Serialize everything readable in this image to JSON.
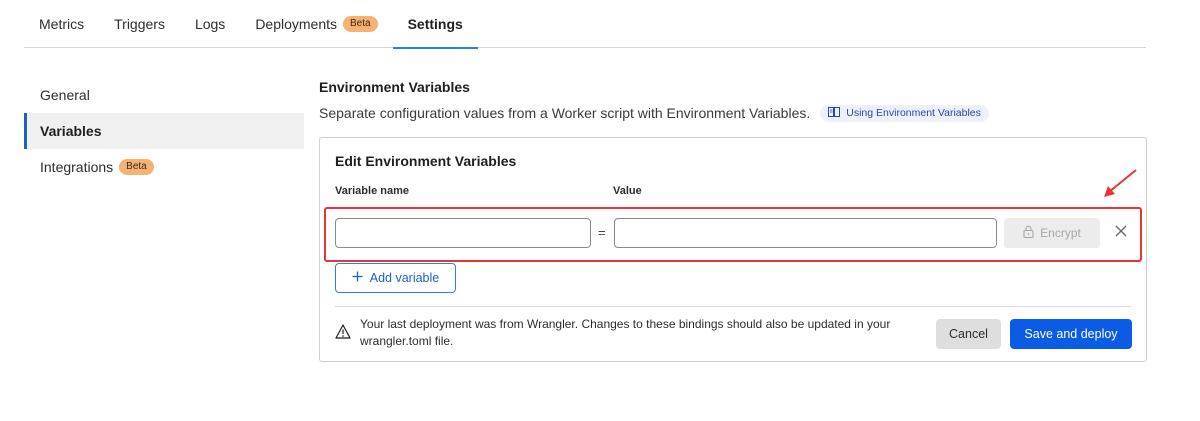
{
  "tabs": [
    {
      "label": "Metrics"
    },
    {
      "label": "Triggers"
    },
    {
      "label": "Logs"
    },
    {
      "label": "Deployments",
      "badge": "Beta"
    },
    {
      "label": "Settings",
      "active": true
    }
  ],
  "sidebar": {
    "items": [
      {
        "label": "General"
      },
      {
        "label": "Variables",
        "active": true
      },
      {
        "label": "Integrations",
        "badge": "Beta"
      }
    ]
  },
  "main": {
    "title": "Environment Variables",
    "description": "Separate configuration values from a Worker script with Environment Variables.",
    "doc_link": "Using Environment Variables",
    "card": {
      "title": "Edit Environment Variables",
      "name_label": "Variable name",
      "value_label": "Value",
      "name_value": "",
      "value_value": "",
      "equals": "=",
      "encrypt_label": "Encrypt",
      "add_label": "Add variable",
      "warning": "Your last deployment was from Wrangler. Changes to these bindings should also be updated in your wrangler.toml file.",
      "cancel_label": "Cancel",
      "save_label": "Save and deploy"
    }
  },
  "icons": {
    "doc_link": "book-icon",
    "encrypt": "lock-icon",
    "remove": "close-icon",
    "add": "plus-icon",
    "warning": "warning-icon"
  },
  "colors": {
    "accent": "#2c7cf4",
    "primary_button": "#0a5ce6",
    "badge": "#f6b173",
    "highlight": "#e5353b"
  }
}
